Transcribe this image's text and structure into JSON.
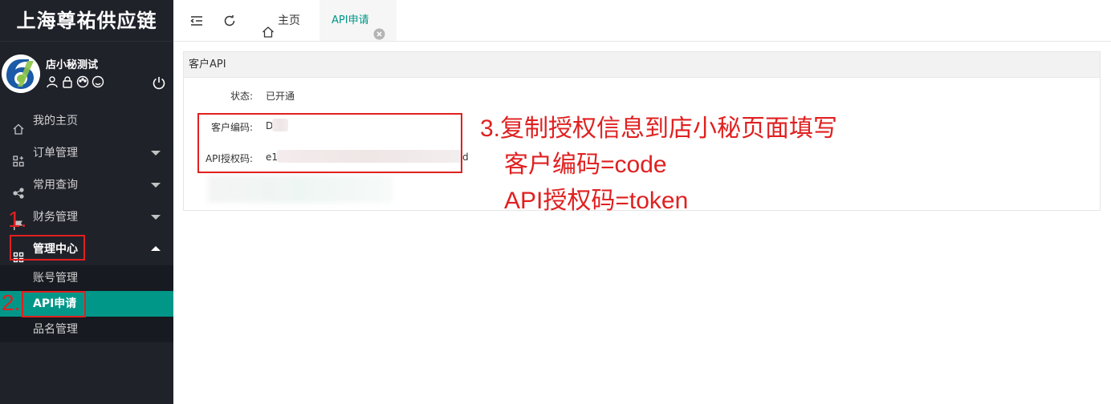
{
  "app": {
    "brand": "上海尊祐供应链"
  },
  "user": {
    "name": "店小秘测试",
    "icons": [
      "user-icon",
      "lock-icon",
      "palette-icon",
      "smile-icon"
    ],
    "power_icon": "power-icon"
  },
  "sidebar": {
    "items": [
      {
        "label": "我的主页",
        "icon": "home-icon"
      },
      {
        "label": "订单管理",
        "icon": "grid-plus-icon",
        "expandable": true
      },
      {
        "label": "常用查询",
        "icon": "share-icon",
        "expandable": true
      },
      {
        "label": "财务管理",
        "icon": "flag-icon",
        "expandable": true
      },
      {
        "label": "管理中心",
        "icon": "apps-icon",
        "expandable": true,
        "expanded": true
      }
    ],
    "submenu": [
      {
        "label": "账号管理"
      },
      {
        "label": "API申请",
        "active": true
      },
      {
        "label": "品名管理"
      }
    ]
  },
  "topbar": {
    "icons": [
      "menu-collapse-icon",
      "refresh-icon"
    ],
    "tabs": [
      {
        "label": "主页",
        "icon": "home-icon"
      },
      {
        "label": "API申请",
        "active": true,
        "closable": true
      }
    ]
  },
  "card": {
    "title": "客户API",
    "fields": [
      {
        "label": "状态:",
        "value": "已开通"
      },
      {
        "label": "客户编码:",
        "value": "D"
      },
      {
        "label": "API授权码:",
        "value_start": "e1",
        "value_end": "d"
      }
    ]
  },
  "annotations": {
    "step1": "1.",
    "step2": "2.",
    "step3_lines": [
      "3.复制授权信息到店小秘页面填写",
      "客户编码=code",
      "API授权码=token"
    ]
  },
  "colors": {
    "sidebar_bg": "#20222a",
    "accent": "#009688",
    "annotation": "#e02020"
  }
}
